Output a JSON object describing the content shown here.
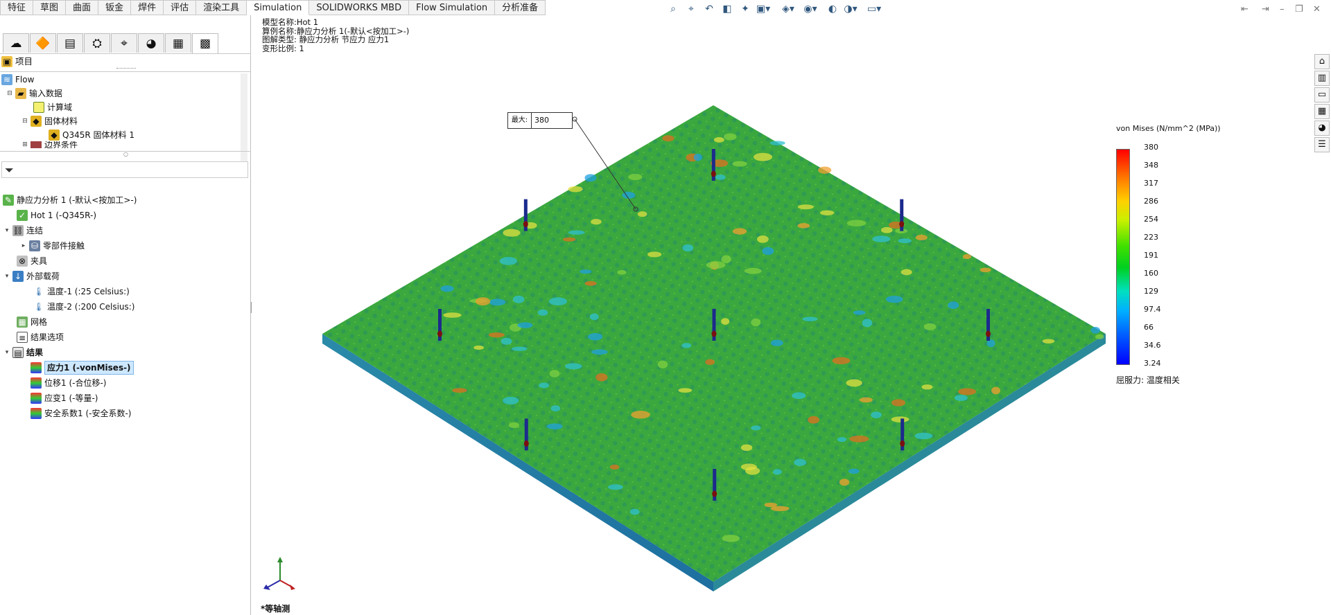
{
  "tabs": [
    "特征",
    "草图",
    "曲面",
    "钣金",
    "焊件",
    "评估",
    "渲染工具",
    "Simulation",
    "SOLIDWORKS MBD",
    "Flow Simulation",
    "分析准备"
  ],
  "active_tab": "Simulation",
  "panel_top": {
    "header": "项目",
    "items": [
      {
        "label": "Flow",
        "icon": "flow-project-icon"
      },
      {
        "label": "输入数据",
        "icon": "folder-icon"
      },
      {
        "label": "计算域",
        "icon": "domain-icon"
      },
      {
        "label": "固体材料",
        "icon": "solid-material-icon"
      },
      {
        "label": "Q345R 固体材料 1",
        "icon": "material-icon"
      },
      {
        "label": "边界条件",
        "icon": "boundary-icon"
      }
    ]
  },
  "filter_icon": "filter-icon",
  "tree": {
    "study": "静应力分析 1 (-默认<按加工>-)",
    "part": "Hot 1 (-Q345R-)",
    "connections": "连结",
    "component_contact": "零部件接触",
    "fixtures": "夹具",
    "external_loads": "外部载荷",
    "temp1": "温度-1 (:25 Celsius:)",
    "temp2": "温度-2 (:200 Celsius:)",
    "mesh": "网格",
    "result_options": "结果选项",
    "results": "结果",
    "stress": "应力1 (-vonMises-)",
    "displacement": "位移1 (-合位移-)",
    "strain": "应变1 (-等量-)",
    "safety": "安全系数1 (-安全系数-)"
  },
  "viewport": {
    "info_lines": [
      "模型名称:Hot 1",
      "算例名称:静应力分析 1(-默认<按加工>-)",
      "图解类型: 静应力分析 节应力 应力1",
      "变形比例: 1"
    ],
    "max_label": "最大:",
    "max_value": "380",
    "view_label": "*等轴测",
    "legend_title": "von Mises (N/mm^2 (MPa))",
    "legend_values": [
      "380",
      "348",
      "317",
      "286",
      "254",
      "223",
      "191",
      "160",
      "129",
      "97.4",
      "66",
      "34.6",
      "3.24"
    ],
    "legend_footer": "屈服力: 温度相关"
  },
  "colors": {
    "plate_main": "#3aa63c",
    "pin": "#1c2a8c",
    "pin_tip": "#7a1010"
  }
}
